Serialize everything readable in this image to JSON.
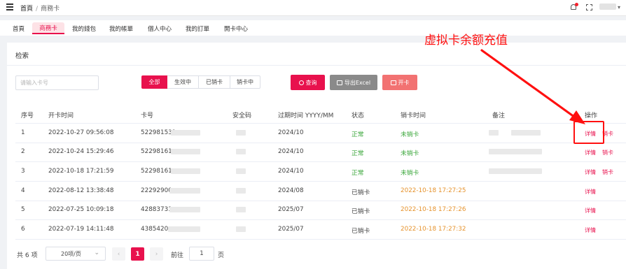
{
  "breadcrumb": {
    "home": "首頁",
    "separator": "/",
    "current": "商務卡"
  },
  "tabs": [
    "首頁",
    "商務卡",
    "我的錢包",
    "我的帳單",
    "個人中心",
    "我的訂單",
    "開卡中心"
  ],
  "panel": {
    "title": "检索"
  },
  "search": {
    "placeholder": "请输入卡号"
  },
  "filters": [
    "全部",
    "生效中",
    "已销卡",
    "销卡中"
  ],
  "actions": {
    "query": "查询",
    "export": "导出Excel",
    "open": "开卡"
  },
  "table": {
    "headers": [
      "序号",
      "开卡时间",
      "卡号",
      "安全码",
      "过期时间 YYYY/MM",
      "状态",
      "销卡时间",
      "备注",
      "操作"
    ],
    "rows": [
      {
        "no": "1",
        "open_time": "2022-10-27 09:56:08",
        "card": "522981531",
        "expiry": "2024/10",
        "status": "正常",
        "cancel": "未销卡",
        "op1": "详情",
        "op2": "销卡"
      },
      {
        "no": "2",
        "open_time": "2022-10-24 15:29:46",
        "card": "52298161",
        "expiry": "2024/10",
        "status": "正常",
        "cancel": "未销卡",
        "op1": "详情",
        "op2": "销卡"
      },
      {
        "no": "3",
        "open_time": "2022-10-18 17:21:59",
        "card": "52298161",
        "expiry": "2024/10",
        "status": "正常",
        "cancel": "未销卡",
        "op1": "详情",
        "op2": "销卡"
      },
      {
        "no": "4",
        "open_time": "2022-08-12 13:38:48",
        "card": "22292900",
        "expiry": "2024/08",
        "status": "已销卡",
        "cancel": "2022-10-18 17:27:25",
        "op1": "详情",
        "op2": ""
      },
      {
        "no": "5",
        "open_time": "2022-07-25 10:09:18",
        "card": "42883731",
        "expiry": "2025/07",
        "status": "已销卡",
        "cancel": "2022-10-18 17:27:26",
        "op1": "详情",
        "op2": ""
      },
      {
        "no": "6",
        "open_time": "2022-07-19 14:11:48",
        "card": "4385420",
        "expiry": "2025/07",
        "status": "已销卡",
        "cancel": "2022-10-18 17:27:32",
        "op1": "详情",
        "op2": ""
      }
    ]
  },
  "pagination": {
    "total": "共 6 项",
    "size": "20项/页",
    "prev": "‹",
    "page": "1",
    "next": "›",
    "goto": "前往",
    "goto_value": "1",
    "unit": "页"
  },
  "annotation": {
    "text": "虚拟卡余额充值",
    "color": "#ff1010"
  },
  "colors": {
    "accent": "#e8114d",
    "green": "#3ba73b",
    "orange": "#e6932d"
  }
}
